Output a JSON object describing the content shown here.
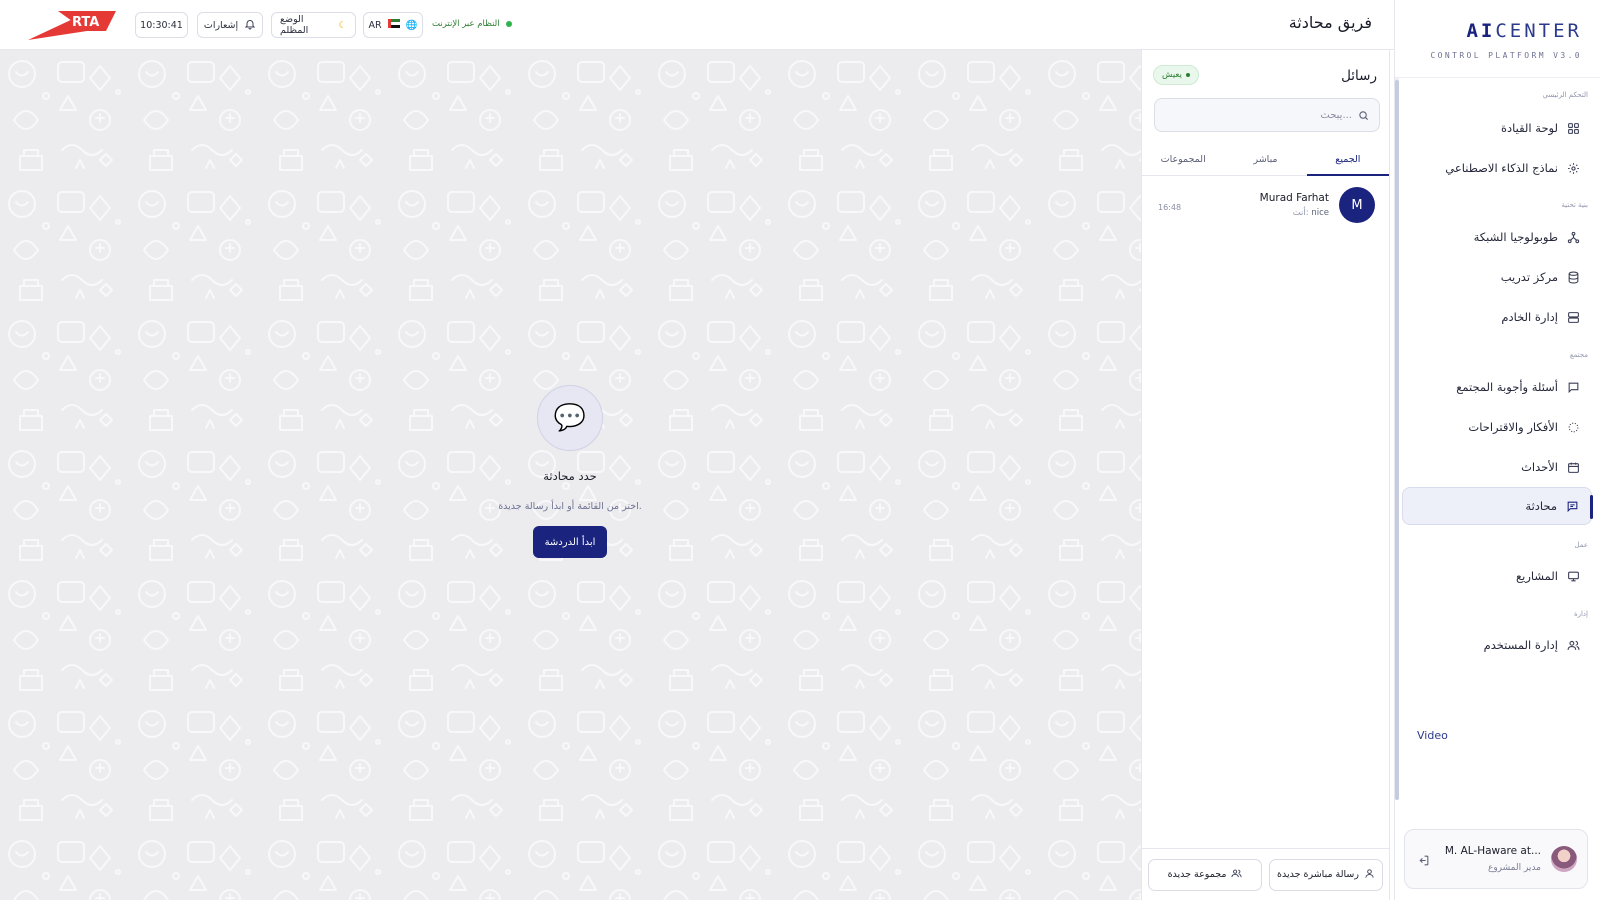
{
  "header": {
    "page_title": "فريق محادثة",
    "clock": "10:30:41",
    "notifications_label": "إشعارات",
    "dark_mode_label": "الوضع المظلم",
    "language_label": "AR",
    "status_label": "النظام عبر الإنترنت",
    "logo_text": "RTA"
  },
  "sidebar": {
    "brand_ai": "AI",
    "brand_center": "CENTER",
    "brand_sub": "CONTROL PLATFORM V3.0",
    "sections": {
      "main": "التحكم الرئيسي",
      "infra": "بنية تحتية",
      "community": "مجتمع",
      "work": "عمل",
      "admin": "إدارة"
    },
    "items": [
      {
        "label": "لوحة القيادة",
        "icon": "dashboard-icon"
      },
      {
        "label": "نماذج الذكاء الاصطناعي",
        "icon": "ai-models-icon"
      },
      {
        "label": "طوبولوجيا الشبكة",
        "icon": "network-icon"
      },
      {
        "label": "مركز تدريب",
        "icon": "database-icon"
      },
      {
        "label": "إدارة الخادم",
        "icon": "server-icon"
      },
      {
        "label": "أسئلة وأجوبة المجتمع",
        "icon": "message-square-icon"
      },
      {
        "label": "الأفكار والاقتراحات",
        "icon": "lightbulb-icon"
      },
      {
        "label": "الأحداث",
        "icon": "calendar-icon"
      },
      {
        "label": "محادثة",
        "icon": "chat-icon"
      },
      {
        "label": "المشاريع",
        "icon": "monitor-icon"
      },
      {
        "label": "إدارة المستخدم",
        "icon": "users-icon"
      }
    ],
    "video_label": "Video",
    "user": {
      "name": "M. AL-Haware at...",
      "role": "مدير المشروع"
    }
  },
  "messages": {
    "title": "رسائل",
    "live_label": "يعيش",
    "search_placeholder": "يبحث...",
    "tabs": [
      "الجميع",
      "مباشر",
      "المجموعات"
    ],
    "conversations": [
      {
        "initial": "M",
        "name": "Murad Farhat",
        "you_prefix": "أنت:",
        "last": "nice",
        "time": "16:48"
      }
    ],
    "new_direct_label": "رسالة مباشرة جديدة",
    "new_group_label": "مجموعة جديدة"
  },
  "chat": {
    "empty_title": "حدد محادثة",
    "empty_sub": "اختر من القائمة أو ابدأ رسالة جديدة.",
    "start_button": "ابدأ الدردشة",
    "empty_icon": "chat-bubble-icon"
  },
  "colors": {
    "accent": "#1a237e",
    "status_green": "#2eb24b",
    "logo_red": "#e53935"
  }
}
